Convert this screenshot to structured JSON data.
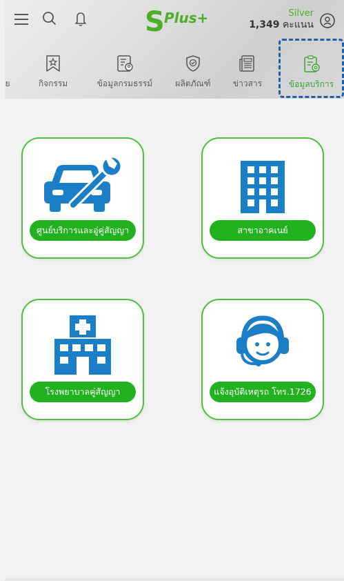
{
  "header": {
    "logo_letter": "S",
    "logo_text": "Plus+",
    "tier": "Silver",
    "points_value": "1,349",
    "points_unit": "คะแนน"
  },
  "tabs": [
    {
      "label": "ย",
      "icon": "partial-icon"
    },
    {
      "label": "กิจกรรม",
      "icon": "star-bookmark-icon"
    },
    {
      "label": "ข้อมูลกรมธรรม์",
      "icon": "policy-document-icon"
    },
    {
      "label": "ผลิตภัณฑ์",
      "icon": "shield-check-icon"
    },
    {
      "label": "ข่าวสาร",
      "icon": "newspaper-icon"
    },
    {
      "label": "ข้อมูลบริการ",
      "icon": "service-document-icon",
      "active": true
    }
  ],
  "cards": [
    {
      "label": "ศูนย์บริการและอู่คู่สัญญา",
      "icon": "car-wrench-icon"
    },
    {
      "label": "สาขาอาคเนย์",
      "icon": "building-icon"
    },
    {
      "label": "โรงพยาบาลคู่สัญญา",
      "icon": "hospital-icon"
    },
    {
      "label": "แจ้งอุบัติเหตุรถ โทร.1726",
      "icon": "call-center-headset-icon"
    }
  ],
  "colors": {
    "brand_green": "#4caf27",
    "button_green": "#22b11f",
    "icon_blue": "#1a7fc6",
    "active_outline": "#1f5fa8"
  }
}
